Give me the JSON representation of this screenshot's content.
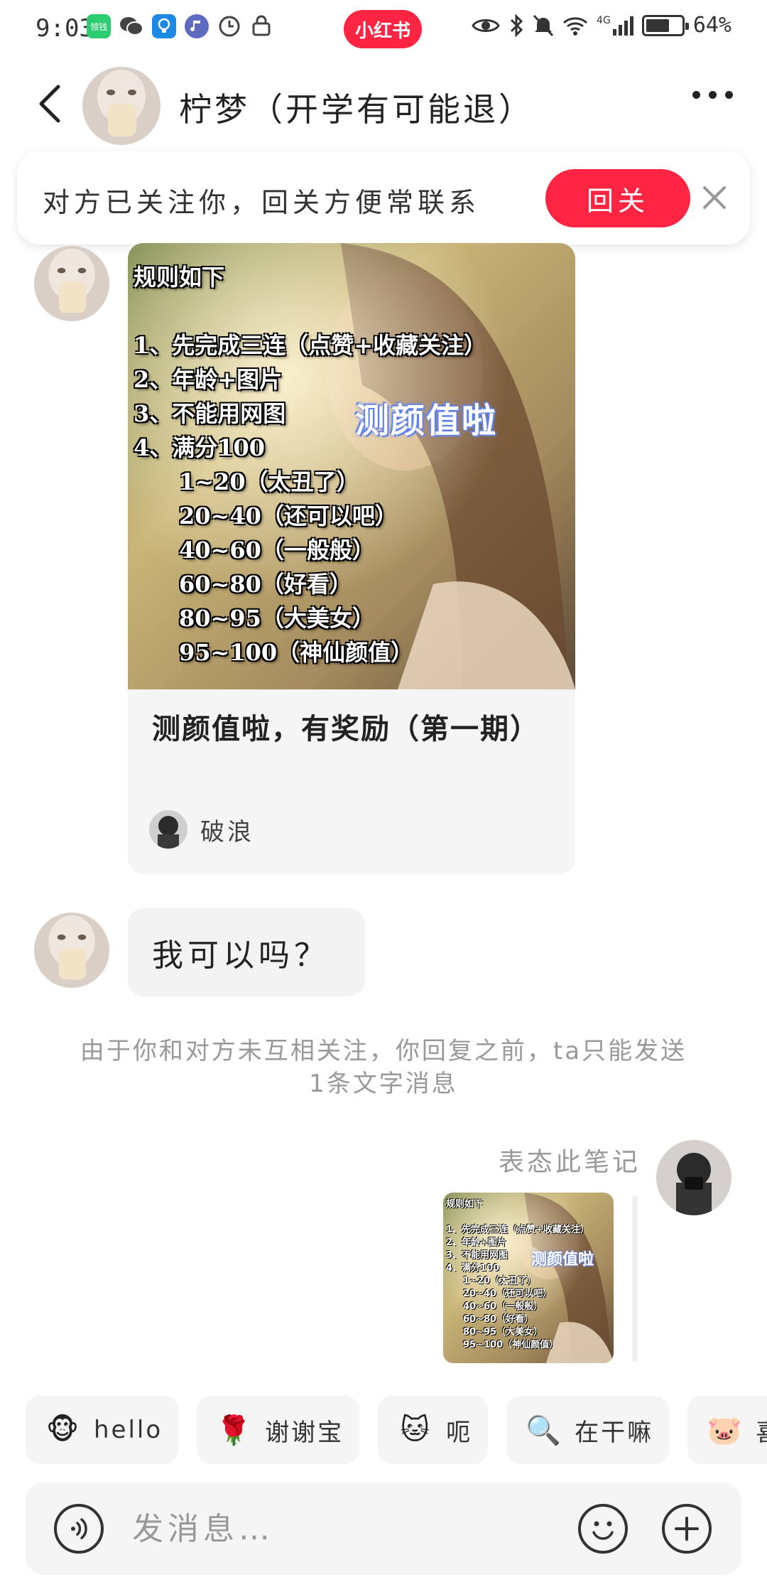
{
  "status_bar": {
    "time": "9:03",
    "app_badge": "小红书",
    "battery": "64%",
    "network": "4G",
    "left_icons": [
      "领钱",
      "wechat-icon",
      "bulb-icon",
      "music-icon",
      "clock-icon",
      "lock-icon"
    ]
  },
  "header": {
    "title": "柠梦（开学有可能退）"
  },
  "follow_banner": {
    "text": "对方已关注你，回关方便常联系",
    "button": "回关"
  },
  "note": {
    "rules": [
      "规则如下",
      "",
      "1、先完成三连（点赞+收藏关注）",
      "2、年龄+图片",
      "3、不能用网图",
      "4、满分100",
      "1~20（太丑了）",
      "20~40（还可以吧）",
      "40~60（一般般）",
      "60~80（好看）",
      "80~95（大美女）",
      "95~100（神仙颜值）"
    ],
    "overlay": "测颜值啦",
    "title": "测颜值啦，有奖励（第一期）",
    "author": "破浪"
  },
  "messages": {
    "text_bubble": "我可以吗？",
    "notice": "由于你和对方未互相关注，你回复之前，ta只能发送1条文字消息",
    "reaction_label": "表态此笔记"
  },
  "chips": [
    {
      "emoji": "🐵",
      "label": "hello"
    },
    {
      "emoji": "🌹",
      "label": "谢谢宝"
    },
    {
      "emoji": "🐱",
      "label": "呃"
    },
    {
      "emoji": "🔍",
      "label": "在干嘛"
    },
    {
      "emoji": "🐷",
      "label": "喜"
    }
  ],
  "input": {
    "placeholder": "发消息…"
  },
  "colors": {
    "accent": "#ff2442",
    "notice_text": "#999999",
    "bubble_bg": "#f3f3f3"
  }
}
